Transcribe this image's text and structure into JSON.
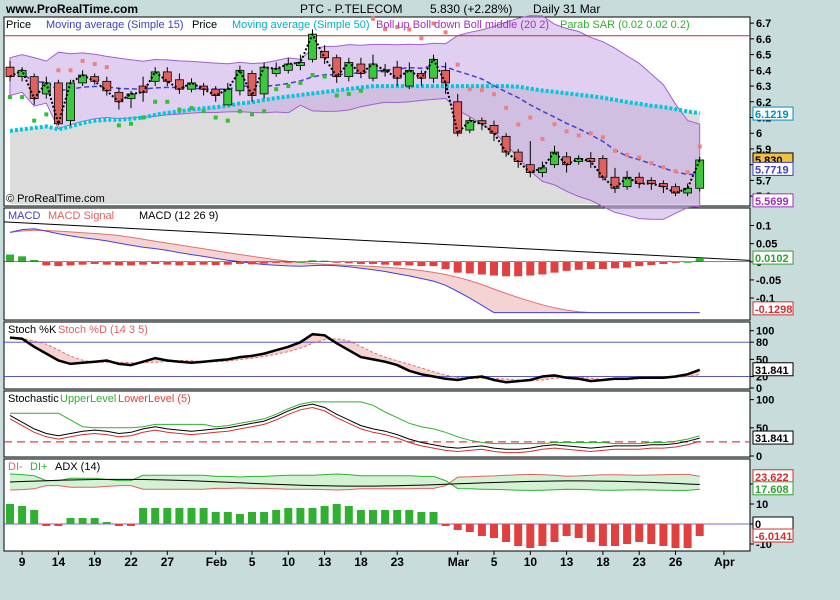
{
  "header": {
    "site": "www.ProRealTime.com",
    "title": "PTC - P.TELECOM",
    "price_info": "5.830 (+2.28%)",
    "period": "Daily  31 Mar"
  },
  "watermark": "© ProRealTime.com",
  "colors": {
    "up_candle": "#3cc83c",
    "down_candle": "#e06060",
    "sma15": "#4040d0",
    "sma50": "#00c8d8",
    "boll_fill": "#c8a8e8",
    "boll_line": "#a060d0",
    "sar": "#f08080",
    "sar_low": "#30c030",
    "macd": "#4040e0",
    "signal": "#e07070",
    "resistance": "#c03030",
    "histo_pos": "#30b030",
    "histo_neg": "#e04040"
  },
  "panels": {
    "price": {
      "legend": [
        {
          "text": "Price",
          "color": "#000000"
        },
        {
          "text": "Moving average (Simple 15)",
          "color": "#4040c0"
        },
        {
          "text": "Price",
          "color": "#000000"
        },
        {
          "text": "Moving average (Simple 50)",
          "color": "#00b0c0"
        },
        {
          "text": "Boll up Boll down Boll middle (20 2)",
          "color": "#a030c0"
        },
        {
          "text": "Parab SAR (0.02 0.02 0.2)",
          "color": "#30b030"
        }
      ],
      "y_ticks": [
        "6.7",
        "6.6",
        "6.5",
        "6.4",
        "6.3",
        "6.2",
        "6.1",
        "6",
        "5.9",
        "5.8",
        "5.7",
        "5.6"
      ],
      "badges": [
        {
          "text": "6.1219",
          "color": "#0090c0",
          "bg": "#ffffff",
          "value": 6.1219
        },
        {
          "text": "5.830",
          "color": "#000000",
          "bg": "#f0c040",
          "value": 5.83
        },
        {
          "text": "5.7719",
          "color": "#4040c0",
          "bg": "#ffffff",
          "value": 5.77
        },
        {
          "text": "5.5699",
          "color": "#a030c0",
          "bg": "#ffffff",
          "value": 5.57
        }
      ]
    },
    "macd": {
      "legend": [
        {
          "text": "MACD",
          "color": "#4040c0"
        },
        {
          "text": "MACD Signal",
          "color": "#e06060"
        },
        {
          "text": "MACD (12 26 9)",
          "color": "#000000"
        }
      ],
      "y_ticks": [
        "0.1",
        "0.05",
        "0",
        "-0.05",
        "-0.1"
      ],
      "badges": [
        {
          "text": "0.0102",
          "color": "#30a030",
          "bg": "#ffffff",
          "value": 0.0102
        },
        {
          "text": "-0.1298",
          "color": "#d03030",
          "bg": "#ffffff",
          "value": -0.1298
        }
      ]
    },
    "stoch": {
      "legend": [
        {
          "text": "Stoch %K",
          "color": "#000000"
        },
        {
          "text": "Stoch %D (14 3 5)",
          "color": "#e06060"
        }
      ],
      "y_ticks": [
        "100",
        "80",
        "50",
        "20",
        "0"
      ],
      "badges": [
        {
          "text": "31.841",
          "color": "#000000",
          "bg": "#ffffff",
          "value": 31.841
        }
      ]
    },
    "stochastic": {
      "legend": [
        {
          "text": "Stochastic",
          "color": "#000000"
        },
        {
          "text": "UpperLevel",
          "color": "#30b030"
        },
        {
          "text": "LowerLevel (5)",
          "color": "#e04040"
        }
      ],
      "y_ticks": [
        "100",
        "50",
        "0"
      ],
      "badges": [
        {
          "text": "31.841",
          "color": "#000000",
          "bg": "#ffffff",
          "value": 31.841
        }
      ]
    },
    "adx": {
      "legend": [
        {
          "text": "DI-",
          "color": "#e06060"
        },
        {
          "text": "DI+",
          "color": "#30b030"
        },
        {
          "text": "ADX (14)",
          "color": "#000000"
        }
      ],
      "y_ticks": [
        "20",
        "10",
        "0",
        "-10"
      ],
      "badges": [
        {
          "text": "23.622",
          "color": "#d03030",
          "bg": "#ffffff",
          "value": 23.622
        },
        {
          "text": "17.608",
          "color": "#30a030",
          "bg": "#ffffff",
          "value": 17.608
        },
        {
          "text": "0",
          "color": "#000000",
          "bg": "#ffffff",
          "value": 0
        },
        {
          "text": "-6.0141",
          "color": "#d03030",
          "bg": "#ffffff",
          "value": -6.0141
        }
      ]
    }
  },
  "x_axis": {
    "labels": [
      {
        "text": "9",
        "bar": 1
      },
      {
        "text": "14",
        "bar": 4
      },
      {
        "text": "19",
        "bar": 7
      },
      {
        "text": "22",
        "bar": 10
      },
      {
        "text": "27",
        "bar": 13
      },
      {
        "text": "Feb",
        "bar": 17
      },
      {
        "text": "5",
        "bar": 20
      },
      {
        "text": "10",
        "bar": 23
      },
      {
        "text": "13",
        "bar": 26
      },
      {
        "text": "18",
        "bar": 29
      },
      {
        "text": "23",
        "bar": 32
      },
      {
        "text": "Mar",
        "bar": 37
      },
      {
        "text": "5",
        "bar": 40
      },
      {
        "text": "10",
        "bar": 43
      },
      {
        "text": "13",
        "bar": 46
      },
      {
        "text": "18",
        "bar": 49
      },
      {
        "text": "23",
        "bar": 52
      },
      {
        "text": "26",
        "bar": 55
      },
      {
        "text": "Apr",
        "bar": 59
      }
    ]
  },
  "chart_data": [
    {
      "type": "line",
      "name": "price",
      "ylim": [
        5.55,
        6.72
      ],
      "candles": [
        [
          6.42,
          6.36,
          6.46,
          6.33
        ],
        [
          6.36,
          6.4,
          6.42,
          6.33
        ],
        [
          6.36,
          6.22,
          6.38,
          6.18
        ],
        [
          6.25,
          6.32,
          6.36,
          6.22
        ],
        [
          6.32,
          6.06,
          6.34,
          6.05
        ],
        [
          6.08,
          6.32,
          6.34,
          6.05
        ],
        [
          6.32,
          6.37,
          6.4,
          6.3
        ],
        [
          6.36,
          6.33,
          6.38,
          6.31
        ],
        [
          6.33,
          6.27,
          6.36,
          6.24
        ],
        [
          6.26,
          6.2,
          6.29,
          6.15
        ],
        [
          6.22,
          6.25,
          6.27,
          6.16
        ],
        [
          6.3,
          6.26,
          6.36,
          6.2
        ],
        [
          6.33,
          6.39,
          6.42,
          6.3
        ],
        [
          6.39,
          6.33,
          6.42,
          6.3
        ],
        [
          6.34,
          6.28,
          6.38,
          6.25
        ],
        [
          6.28,
          6.32,
          6.35,
          6.26
        ],
        [
          6.3,
          6.28,
          6.32,
          6.24
        ],
        [
          6.28,
          6.24,
          6.3,
          6.2
        ],
        [
          6.18,
          6.28,
          6.32,
          6.18
        ],
        [
          6.27,
          6.4,
          6.43,
          6.24
        ],
        [
          6.38,
          6.24,
          6.4,
          6.2
        ],
        [
          6.25,
          6.42,
          6.45,
          6.22
        ],
        [
          6.38,
          6.41,
          6.45,
          6.36
        ],
        [
          6.4,
          6.44,
          6.48,
          6.38
        ],
        [
          6.43,
          6.45,
          6.5,
          6.4
        ],
        [
          6.47,
          6.63,
          6.66,
          6.45
        ],
        [
          6.52,
          6.48,
          6.56,
          6.44
        ],
        [
          6.48,
          6.36,
          6.5,
          6.32
        ],
        [
          6.36,
          6.45,
          6.48,
          6.33
        ],
        [
          6.44,
          6.38,
          6.48,
          6.35
        ],
        [
          6.35,
          6.44,
          6.5,
          6.33
        ],
        [
          6.4,
          6.4,
          6.44,
          6.36
        ],
        [
          6.42,
          6.35,
          6.46,
          6.3
        ],
        [
          6.3,
          6.4,
          6.45,
          6.28
        ],
        [
          6.38,
          6.35,
          6.4,
          6.3
        ],
        [
          6.35,
          6.47,
          6.5,
          6.32
        ],
        [
          6.4,
          6.32,
          6.45,
          6.25
        ],
        [
          6.2,
          6.0,
          6.25,
          5.98
        ],
        [
          6.02,
          6.08,
          6.1,
          6.0
        ],
        [
          6.08,
          6.06,
          6.1,
          6.02
        ],
        [
          6.05,
          6.0,
          6.08,
          5.95
        ],
        [
          5.98,
          5.88,
          6.0,
          5.85
        ],
        [
          5.88,
          5.82,
          5.9,
          5.78
        ],
        [
          5.8,
          5.75,
          5.95,
          5.72
        ],
        [
          5.75,
          5.78,
          5.82,
          5.72
        ],
        [
          5.8,
          5.88,
          5.92,
          5.78
        ],
        [
          5.85,
          5.8,
          5.88,
          5.75
        ],
        [
          5.82,
          5.84,
          5.86,
          5.8
        ],
        [
          5.84,
          5.82,
          5.88,
          5.78
        ],
        [
          5.84,
          5.72,
          5.86,
          5.7
        ],
        [
          5.72,
          5.65,
          5.78,
          5.62
        ],
        [
          5.66,
          5.72,
          5.76,
          5.64
        ],
        [
          5.72,
          5.68,
          5.75,
          5.65
        ],
        [
          5.7,
          5.68,
          5.72,
          5.64
        ],
        [
          5.68,
          5.66,
          5.7,
          5.62
        ],
        [
          5.66,
          5.62,
          5.68,
          5.6
        ],
        [
          5.62,
          5.65,
          5.68,
          5.6
        ],
        [
          5.65,
          5.83,
          5.85,
          5.63
        ]
      ]
    },
    {
      "type": "bar",
      "name": "macd",
      "ylim": [
        -0.155,
        0.14
      ],
      "macd_hist": [
        0.02,
        0.015,
        0.005,
        -0.01,
        -0.012,
        -0.01,
        -0.008,
        -0.006,
        -0.008,
        -0.01,
        -0.01,
        -0.008,
        -0.006,
        -0.008,
        -0.01,
        -0.009,
        -0.008,
        -0.009,
        -0.008,
        -0.006,
        -0.007,
        -0.005,
        -0.003,
        -0.002,
        0.0,
        0.004,
        0.003,
        -0.002,
        -0.004,
        -0.006,
        -0.006,
        -0.008,
        -0.01,
        -0.01,
        -0.012,
        -0.012,
        -0.02,
        -0.03,
        -0.032,
        -0.035,
        -0.038,
        -0.04,
        -0.04,
        -0.038,
        -0.035,
        -0.03,
        -0.025,
        -0.022,
        -0.02,
        -0.02,
        -0.018,
        -0.016,
        -0.012,
        -0.009,
        -0.006,
        -0.003,
        0.0,
        0.01
      ]
    },
    {
      "type": "line",
      "name": "stoch",
      "ylim": [
        0,
        110
      ],
      "k": [
        88,
        86,
        72,
        60,
        48,
        42,
        44,
        46,
        48,
        42,
        40,
        46,
        52,
        48,
        46,
        44,
        46,
        48,
        50,
        54,
        56,
        60,
        66,
        72,
        80,
        94,
        92,
        78,
        66,
        54,
        50,
        46,
        40,
        30,
        24,
        20,
        16,
        14,
        18,
        20,
        14,
        10,
        12,
        14,
        20,
        22,
        18,
        16,
        12,
        14,
        16,
        16,
        18,
        18,
        18,
        20,
        24,
        31.841
      ]
    },
    {
      "type": "line",
      "name": "stochastic",
      "ylim": [
        0,
        110
      ],
      "s": [
        72,
        60,
        48,
        40,
        36,
        40,
        44,
        46,
        44,
        40,
        42,
        48,
        52,
        48,
        46,
        44,
        46,
        48,
        50,
        54,
        58,
        62,
        70,
        80,
        88,
        92,
        86,
        74,
        64,
        54,
        48,
        44,
        38,
        30,
        24,
        20,
        16,
        14,
        16,
        18,
        14,
        12,
        12,
        14,
        18,
        20,
        18,
        16,
        14,
        16,
        18,
        18,
        18,
        20,
        20,
        22,
        26,
        31.841
      ]
    },
    {
      "type": "bar",
      "name": "adx",
      "ylim": [
        -13,
        31
      ],
      "adx_hist": [
        10,
        9,
        7,
        -1,
        -1,
        3,
        3,
        3,
        1,
        -1,
        -1,
        8,
        8,
        8,
        8,
        8,
        8,
        6,
        6,
        5,
        6,
        6,
        7,
        8,
        8,
        8,
        9,
        10,
        9,
        7,
        7,
        7,
        7,
        7,
        6,
        6,
        -1,
        -3,
        -4,
        -6,
        -7,
        -9,
        -11,
        -12,
        -11,
        -9,
        -6,
        -7,
        -9,
        -11,
        -11,
        -10,
        -9,
        -10,
        -11,
        -12,
        -12,
        -6
      ]
    }
  ]
}
